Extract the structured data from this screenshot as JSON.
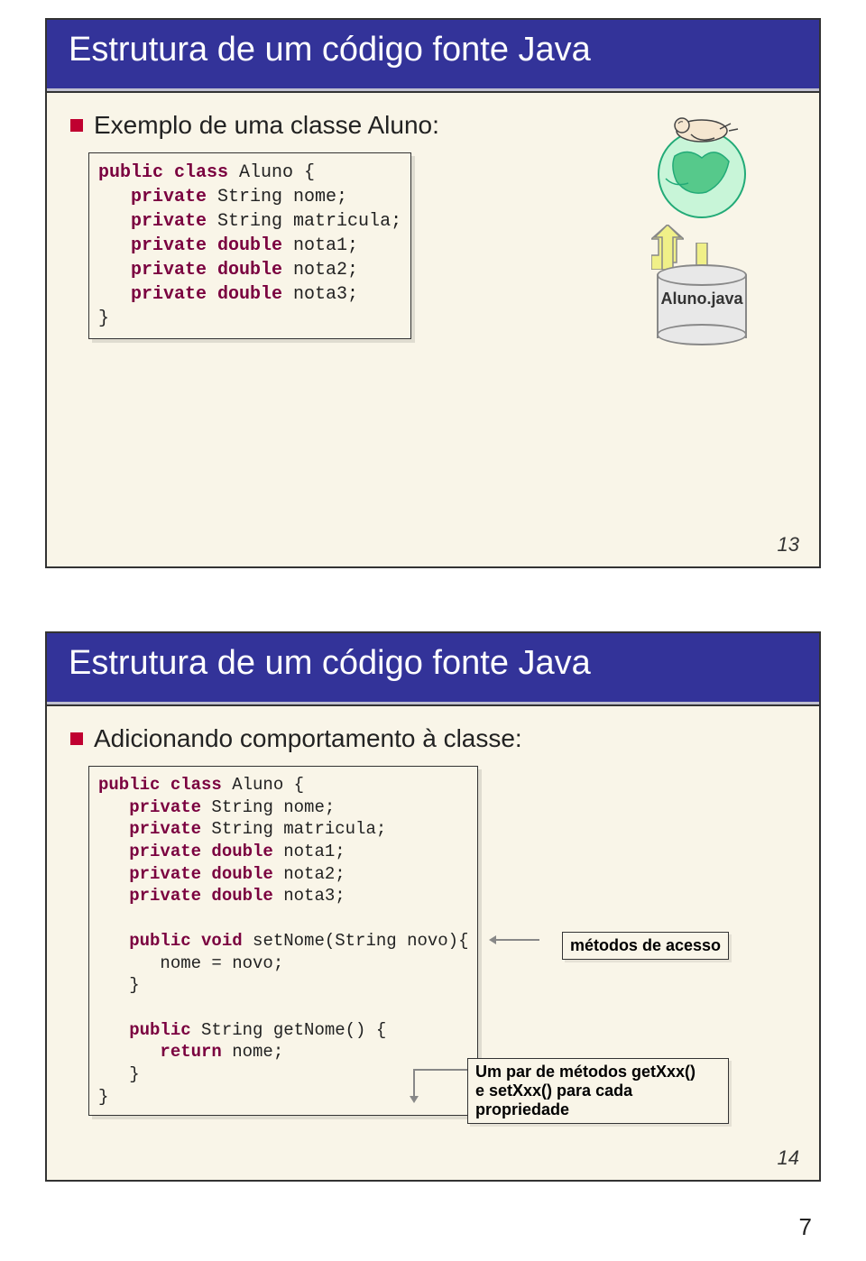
{
  "slide1": {
    "title": "Estrutura de um código fonte Java",
    "bullet": "Exemplo de uma classe Aluno:",
    "cylinder_label": "Aluno.java",
    "code": {
      "l1a": "public class",
      "l1b": " Aluno {",
      "l2a": "   private",
      "l2b": " String nome;",
      "l3a": "   private",
      "l3b": " String matricula;",
      "l4a": "   private double",
      "l4b": " nota1;",
      "l5a": "   private double",
      "l5b": " nota2;",
      "l6a": "   private double",
      "l6b": " nota3;",
      "l7": "}"
    },
    "num": "13"
  },
  "slide2": {
    "title": "Estrutura de um código fonte Java",
    "bullet": "Adicionando comportamento à classe:",
    "code": {
      "l1a": "public class",
      "l1b": " Aluno {",
      "l2a": "   private",
      "l2b": " String nome;",
      "l3a": "   private",
      "l3b": " String matricula;",
      "l4a": "   private double",
      "l4b": " nota1;",
      "l5a": "   private double",
      "l5b": " nota2;",
      "l6a": "   private double",
      "l6b": " nota3;",
      "blank1": " ",
      "l7a": "   public void",
      "l7b": " setNome(String novo){",
      "l8": "      nome = novo;",
      "l9": "   }",
      "blank2": " ",
      "l10a": "   public",
      "l10b": " String getNome() {",
      "l11a": "      return",
      "l11b": " nome;",
      "l12": "   }",
      "l13": "}"
    },
    "annot1": "métodos de acesso",
    "annot2_l1": "Um par de métodos getXxx()",
    "annot2_l2": "e setXxx() para cada propriedade",
    "num": "14"
  },
  "page_num": "7"
}
